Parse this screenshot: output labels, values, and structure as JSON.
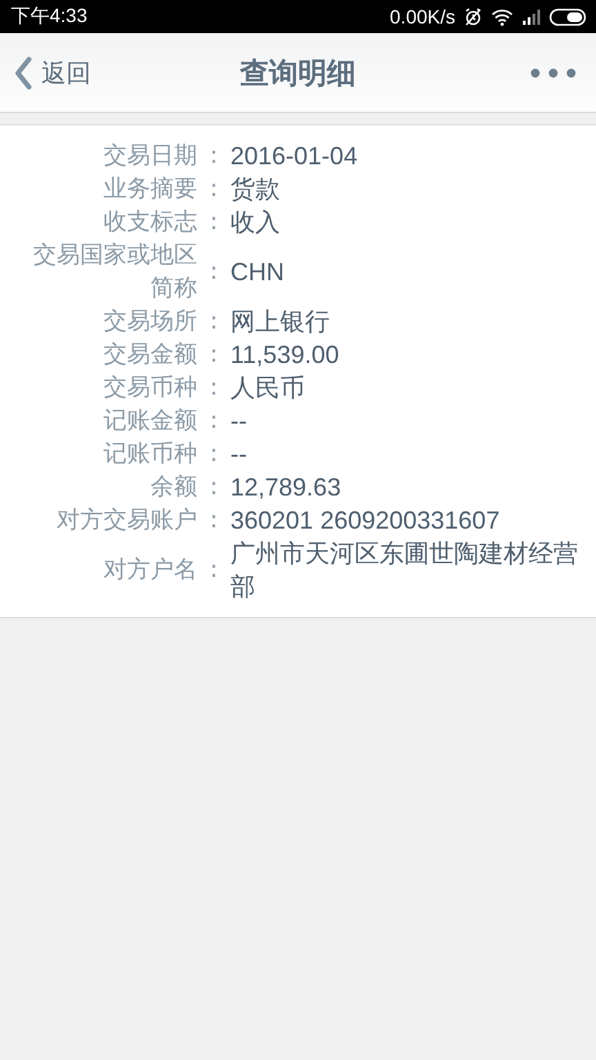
{
  "status_bar": {
    "time": "下午4:33",
    "net_speed": "0.00K/s"
  },
  "header": {
    "back_label": "返回",
    "title": "查询明细"
  },
  "details": [
    {
      "label": "交易日期",
      "colon": ":",
      "value": "2016-01-04"
    },
    {
      "label": "业务摘要",
      "colon": ":",
      "value": "货款"
    },
    {
      "label": "收支标志",
      "colon": ":",
      "value": "收入"
    },
    {
      "label": "交易国家或地区简称",
      "colon": ":",
      "value": "CHN"
    },
    {
      "label": "交易场所",
      "colon": ":",
      "value": "网上银行"
    },
    {
      "label": "交易金额",
      "colon": ":",
      "value": "11,539.00"
    },
    {
      "label": "交易币种",
      "colon": ":",
      "value": "人民币"
    },
    {
      "label": "记账金额",
      "colon": ":",
      "value": "--"
    },
    {
      "label": "记账币种",
      "colon": ":",
      "value": "--"
    },
    {
      "label": "余额",
      "colon": ":",
      "value": "12,789.63"
    },
    {
      "label": "对方交易账户",
      "colon": ":",
      "value": "360201 2609200331607"
    },
    {
      "label": "对方户名",
      "colon": ":",
      "value": "广州市天河区东圃世陶建材经营部"
    }
  ]
}
